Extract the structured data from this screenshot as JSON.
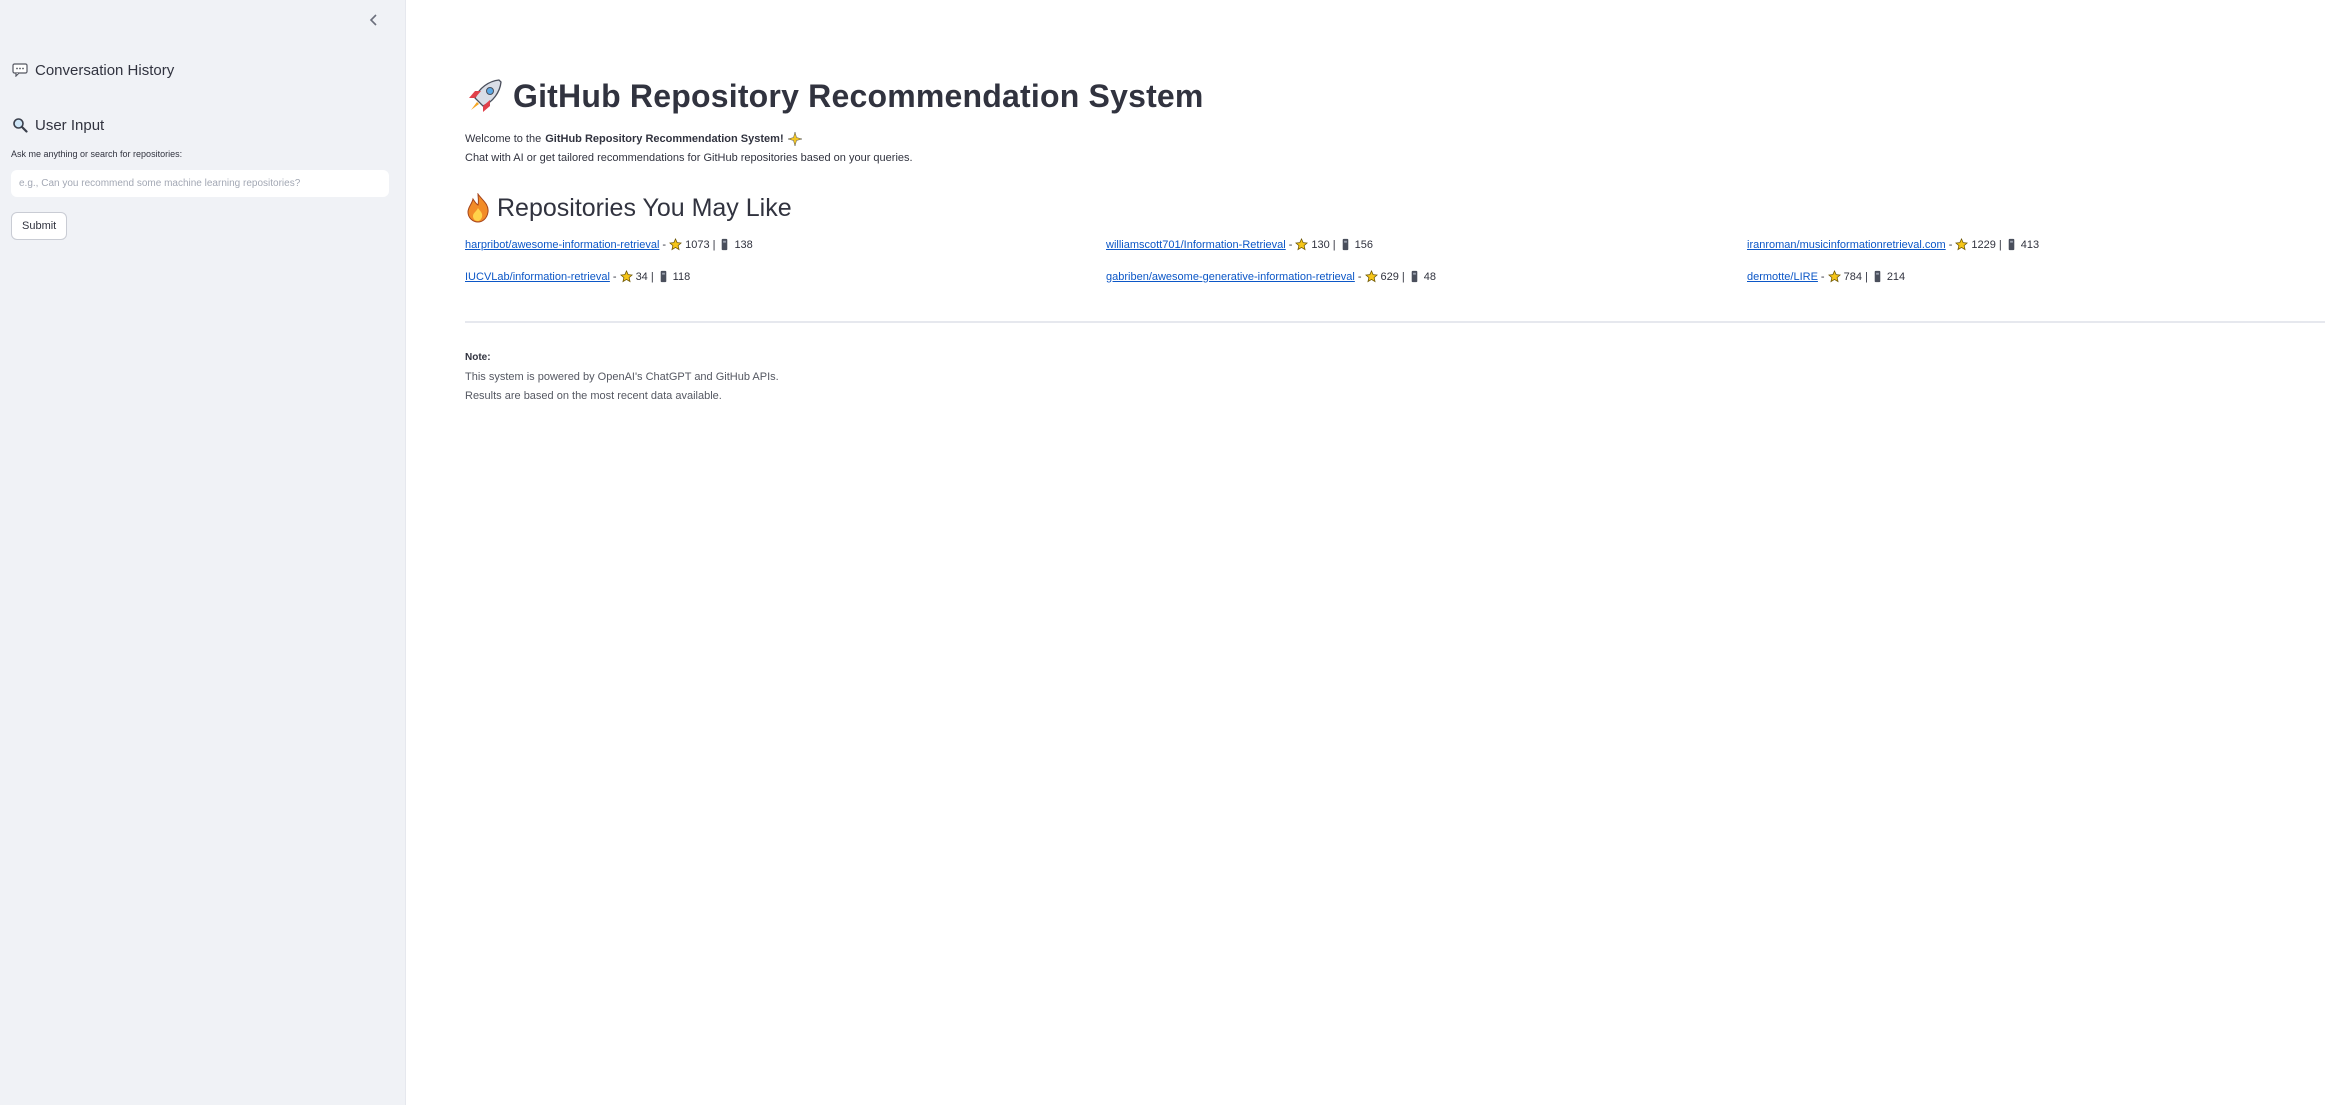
{
  "sidebar": {
    "history_title": "Conversation History",
    "input_title": "User Input",
    "field_label": "Ask me anything or search for repositories:",
    "placeholder": "e.g., Can you recommend some machine learning repositories?",
    "submit_label": "Submit"
  },
  "main": {
    "title": "GitHub Repository Recommendation System",
    "welcome_prefix": "Welcome to the",
    "welcome_bold": "GitHub Repository Recommendation System!",
    "subtitle": "Chat with AI or get tailored recommendations for GitHub repositories based on your queries.",
    "section_title": "Repositories You May Like",
    "repos": [
      {
        "name": "harpribot/awesome-information-retrieval",
        "stars": "1073",
        "forks": "138"
      },
      {
        "name": "williamscott701/Information-Retrieval",
        "stars": "130",
        "forks": "156"
      },
      {
        "name": "iranroman/musicinformationretrieval.com",
        "stars": "1229",
        "forks": "413"
      },
      {
        "name": "IUCVLab/information-retrieval",
        "stars": "34",
        "forks": "118"
      },
      {
        "name": "gabriben/awesome-generative-information-retrieval",
        "stars": "629",
        "forks": "48"
      },
      {
        "name": "dermotte/LIRE",
        "stars": "784",
        "forks": "214"
      }
    ],
    "separator": "-",
    "pipe": "|",
    "note_label": "Note:",
    "note_line1": "This system is powered by OpenAI's ChatGPT and GitHub APIs.",
    "note_line2": "Results are based on the most recent data available."
  },
  "colors": {
    "sidebar_bg": "#f0f2f6",
    "link": "#0c57c7",
    "text": "#31333f"
  },
  "icons": {
    "collapse": "chevron-left-icon",
    "history": "speech-bubble-icon",
    "input": "magnifier-icon",
    "title": "rocket-icon",
    "welcome": "sparkle-icon",
    "section": "fire-icon",
    "star": "star-icon",
    "fork": "fork-icon"
  }
}
